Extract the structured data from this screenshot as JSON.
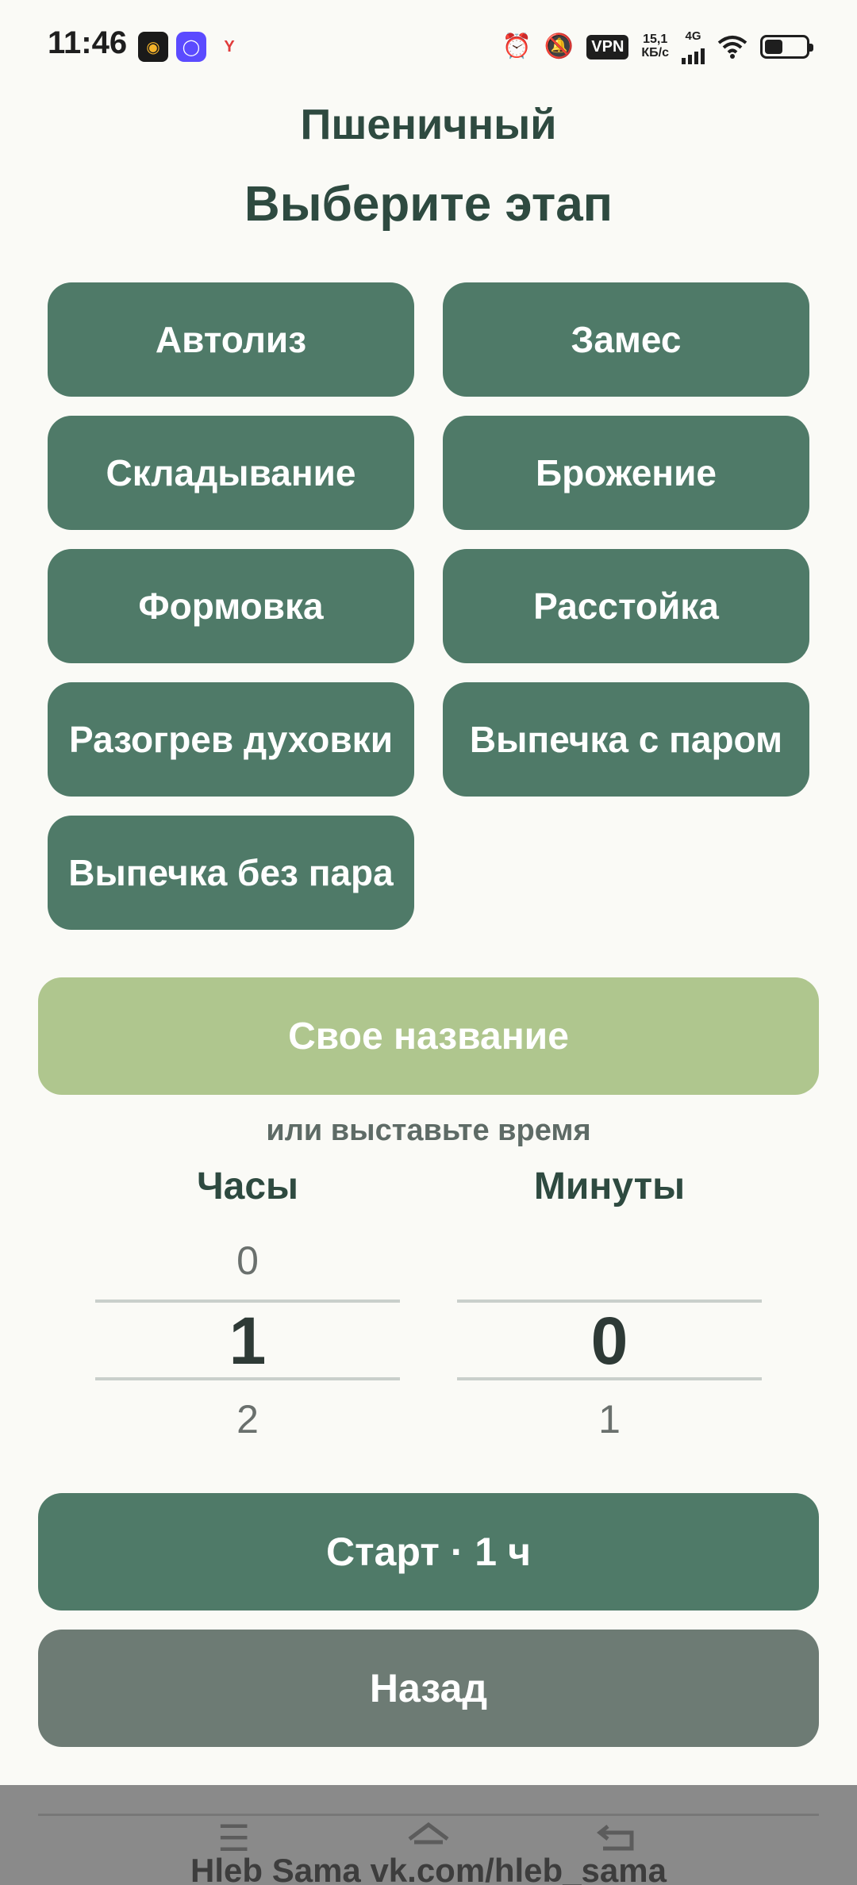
{
  "status_bar": {
    "time": "11:46",
    "app_icons": [
      "photo-editor-app-icon",
      "messenger-app-icon",
      "yandex-app-icon"
    ],
    "vpn_label": "VPN",
    "speed_value": "15,1",
    "speed_unit": "КБ/с",
    "network_type": "4G"
  },
  "header": {
    "bread_type": "Пшеничный",
    "title": "Выберите этап"
  },
  "stages": [
    "Автолиз",
    "Замес",
    "Складывание",
    "Брожение",
    "Формовка",
    "Расстойка",
    "Разогрев духовки",
    "Выпечка с паром",
    "Выпечка без пара"
  ],
  "custom_name_label": "Свое название",
  "or_time_label": "или выставьте время",
  "hours": {
    "label": "Часы",
    "prev": "0",
    "selected": "1",
    "next": "2"
  },
  "minutes": {
    "label": "Минуты",
    "prev": "",
    "selected": "0",
    "next": "1"
  },
  "start_label": "Старт · 1 ч",
  "back_label": "Назад",
  "footer": "Hleb Sama vk.com/hleb_sama",
  "colors": {
    "primary": "#4f7a68",
    "accent_light": "#afc68e",
    "secondary": "#6d7b74",
    "background": "#fafaf6",
    "text": "#2e4a40"
  }
}
